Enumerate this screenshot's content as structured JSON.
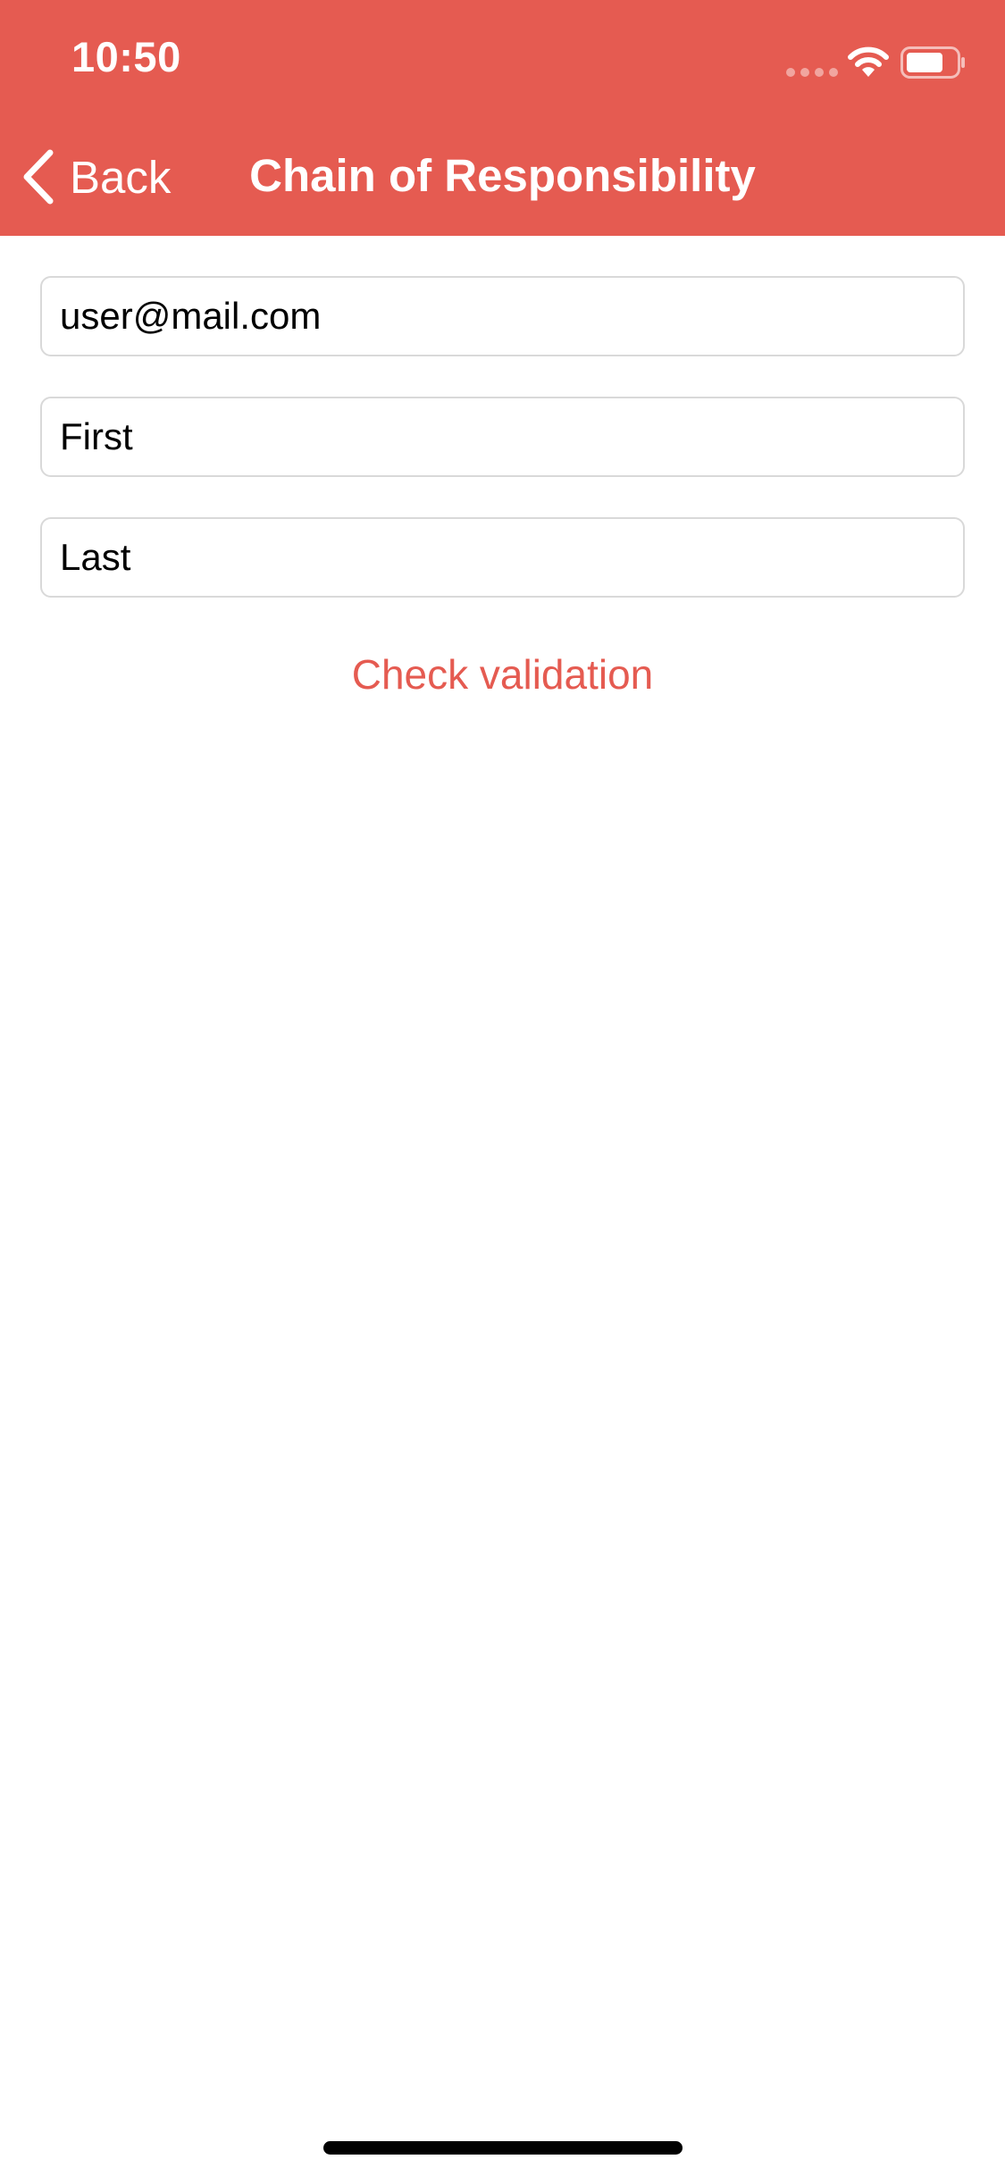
{
  "status_bar": {
    "time": "10:50"
  },
  "nav_bar": {
    "back_label": "Back",
    "title": "Chain of Responsibility",
    "background_color": "#E55B51"
  },
  "form": {
    "email_field": {
      "value": "user@mail.com"
    },
    "first_name_field": {
      "value": "First"
    },
    "last_name_field": {
      "value": "Last"
    },
    "check_button_label": "Check validation",
    "accent_color": "#E55B51"
  },
  "icons": [
    "signal-icon",
    "wifi-icon",
    "battery-icon",
    "chevron-left-icon"
  ]
}
